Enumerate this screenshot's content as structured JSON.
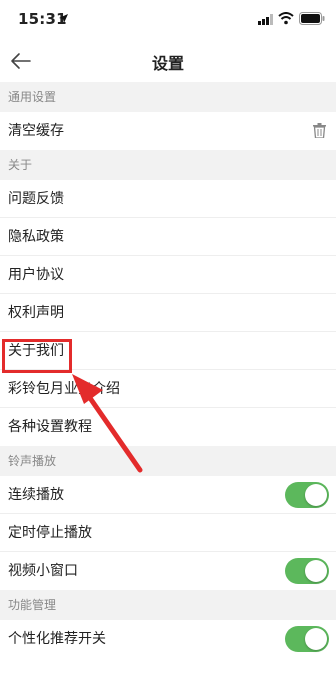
{
  "status": {
    "time": "15:31"
  },
  "nav": {
    "title": "设置"
  },
  "sections": [
    {
      "header": "通用设置",
      "rows": [
        {
          "label": "清空缓存"
        }
      ]
    },
    {
      "header": "关于",
      "rows": [
        {
          "label": "问题反馈"
        },
        {
          "label": "隐私政策"
        },
        {
          "label": "用户协议"
        },
        {
          "label": "权利声明"
        },
        {
          "label": "关于我们"
        },
        {
          "label": "彩铃包月业务介绍"
        },
        {
          "label": "各种设置教程"
        }
      ]
    },
    {
      "header": "铃声播放",
      "rows": [
        {
          "label": "连续播放",
          "toggle_on": true
        },
        {
          "label": "定时停止播放"
        },
        {
          "label": "视频小窗口",
          "toggle_on": true
        }
      ]
    },
    {
      "header": "功能管理",
      "rows": [
        {
          "label": "个性化推荐开关",
          "toggle_on": true
        }
      ]
    }
  ],
  "colors": {
    "toggle_on": "#5cb85c",
    "annotation": "#e32b2b",
    "section_bg": "#f2f2f2"
  }
}
